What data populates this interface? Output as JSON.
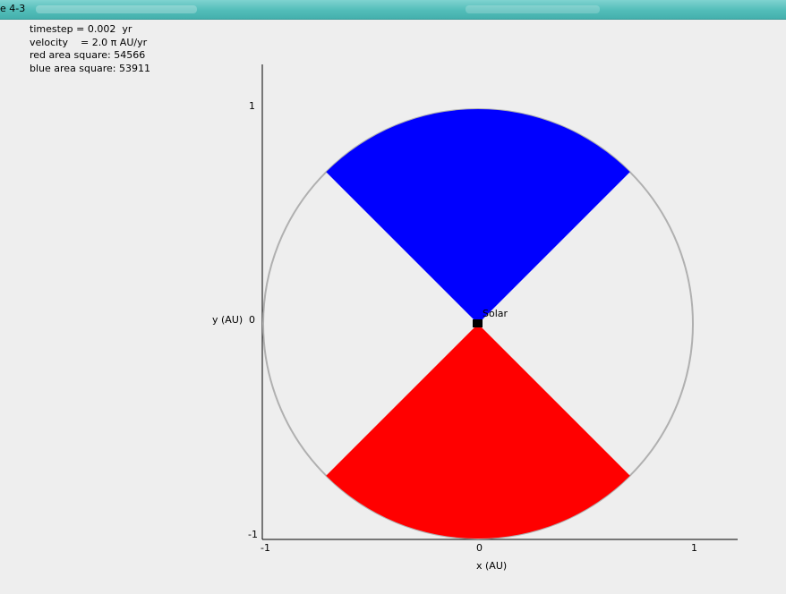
{
  "window": {
    "title": "e 4-3"
  },
  "info": {
    "timestep": "timestep = 0.002  yr",
    "velocity": "velocity    = 2.0 π AU/yr",
    "red_area": "red area square: 54566",
    "blue_area": "blue area square: 53911"
  },
  "plot": {
    "xlabel": "x (AU)",
    "ylabel": "y (AU)",
    "x_ticks": [
      "-1",
      "0",
      "1"
    ],
    "y_ticks": [
      "1",
      "0",
      "-1"
    ],
    "sun_label": "Solar"
  },
  "colors": {
    "orbit": "#b0b0b0",
    "red_sector": "#ff0000",
    "blue_sector": "#0000ff",
    "sun": "#000000",
    "titlebar": "#52bdb9"
  },
  "chart_data": {
    "type": "scatter",
    "xlabel": "x (AU)",
    "ylabel": "y (AU)",
    "xlim": [
      -1,
      1.2
    ],
    "ylim": [
      -1,
      1.2
    ],
    "orbit_radius": 1.0,
    "sun_position": [
      0,
      0
    ],
    "sectors": [
      {
        "color": "red",
        "start_angle_deg": 225,
        "end_angle_deg": 315,
        "area": 54566
      },
      {
        "color": "blue",
        "start_angle_deg": 45,
        "end_angle_deg": 135,
        "area": 53911
      }
    ]
  }
}
